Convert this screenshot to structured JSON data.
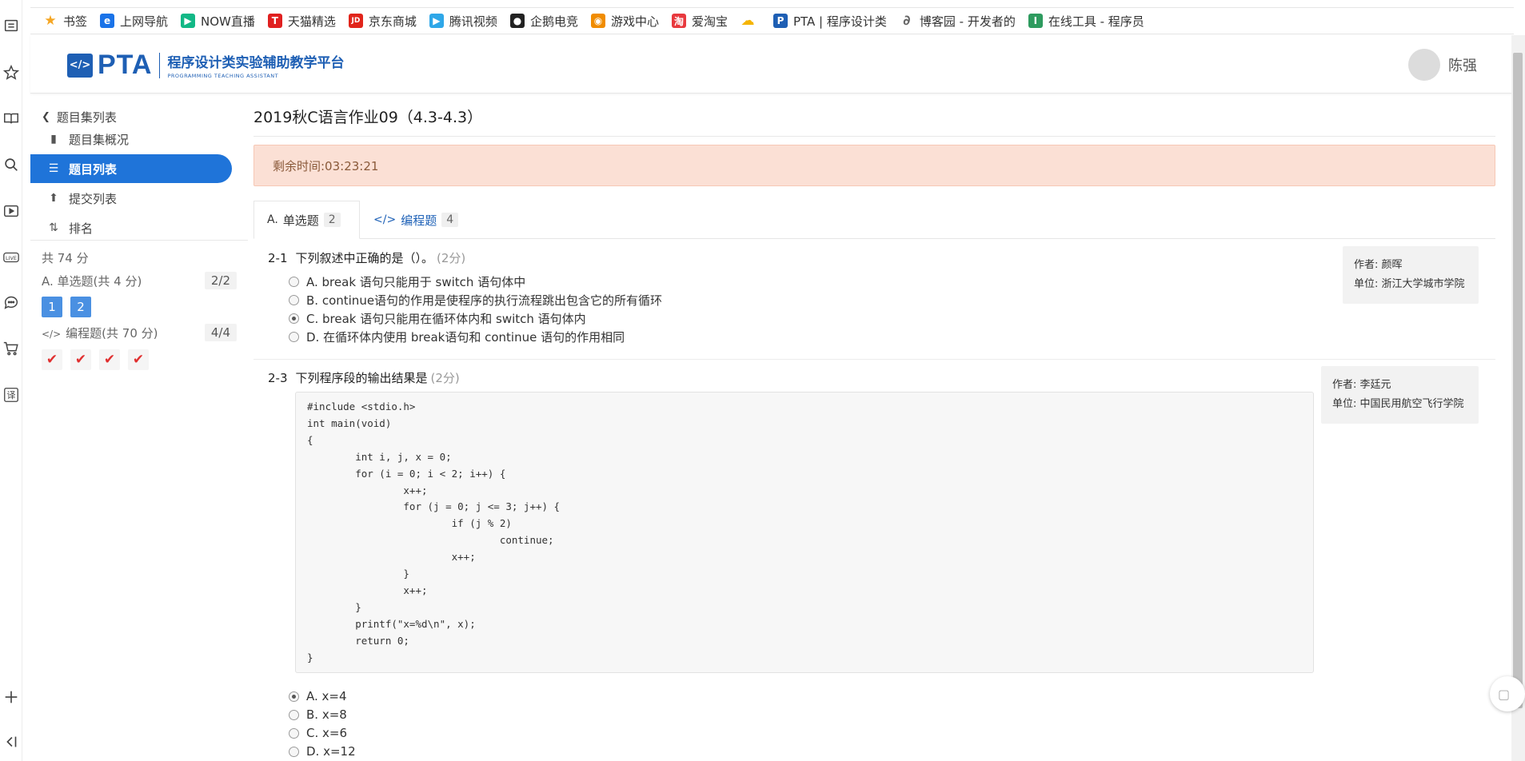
{
  "bookmarks": [
    {
      "label": "书签",
      "icon": "star-icon",
      "color": "#f5a623"
    },
    {
      "label": "上网导航",
      "icon": "ie-icon",
      "color": "#1a73e8"
    },
    {
      "label": "NOW直播",
      "icon": "now-icon",
      "color": "#12b886"
    },
    {
      "label": "天猫精选",
      "icon": "tmall-icon",
      "color": "#e02020"
    },
    {
      "label": "京东商城",
      "icon": "jd-icon",
      "color": "#e1251b"
    },
    {
      "label": "腾讯视频",
      "icon": "tencent-video-icon",
      "color": "#2fa7e8"
    },
    {
      "label": "企鹅电竞",
      "icon": "penguin-icon",
      "color": "#222222"
    },
    {
      "label": "游戏中心",
      "icon": "gamepad-icon",
      "color": "#f08c00"
    },
    {
      "label": "爱淘宝",
      "icon": "taobao-icon",
      "color": "#e8393e"
    },
    {
      "label": "",
      "icon": "cloud-icon",
      "color": "#f5b400"
    },
    {
      "label": "PTA | 程序设计类",
      "icon": "pta-icon",
      "color": "#1e5fb4"
    },
    {
      "label": "博客园 - 开发者的",
      "icon": "cnblogs-icon",
      "color": "#666666"
    },
    {
      "label": "在线工具 - 程序员",
      "icon": "tool-icon",
      "color": "#2e9b5f"
    }
  ],
  "header": {
    "logo_mark": "</>",
    "logo_text": "PTA",
    "platform_title": "程序设计类实验辅助教学平台",
    "platform_subtitle": "PROGRAMMING TEACHING ASSISTANT",
    "user_name": "陈强"
  },
  "sidebar": {
    "back_label": "题目集列表",
    "nav": [
      {
        "label": "题目集概况",
        "icon": "book-icon",
        "active": false
      },
      {
        "label": "题目列表",
        "icon": "list-icon",
        "active": true
      },
      {
        "label": "提交列表",
        "icon": "upload-icon",
        "active": false
      },
      {
        "label": "排名",
        "icon": "sort-icon",
        "active": false
      }
    ],
    "total": "共 74 分",
    "groups": [
      {
        "label": "A. 单选题(共 4 分)",
        "count": "2/2",
        "chips": [
          "1",
          "2"
        ]
      },
      {
        "label": "编程题(共 70 分)",
        "count": "4/4",
        "chips": [
          "✔",
          "✔",
          "✔",
          "✔"
        ]
      }
    ]
  },
  "main": {
    "title": "2019秋C语言作业09（4.3-4.3）",
    "timer": "剩余时间:03:23:21",
    "tabs": [
      {
        "label": "单选题",
        "prefix": "A.",
        "count": "2"
      },
      {
        "label": "编程题",
        "prefix": "</>",
        "count": "4"
      }
    ],
    "questions": [
      {
        "number": "2-1",
        "text": "下列叙述中正确的是（）。",
        "points": "(2分)",
        "author": "作者: 颜晖",
        "unit": "单位: 浙江大学城市学院",
        "options": [
          {
            "label": "A. break 语句只能用于 switch 语句体中",
            "selected": false
          },
          {
            "label": "B. continue语句的作用是使程序的执行流程跳出包含它的所有循环",
            "selected": false
          },
          {
            "label": "C. break 语句只能用在循环体内和 switch 语句体内",
            "selected": true
          },
          {
            "label": "D. 在循环体内使用 break语句和 continue 语句的作用相同",
            "selected": false
          }
        ]
      },
      {
        "number": "2-3",
        "text": "下列程序段的输出结果是",
        "points": "(2分)",
        "author": "作者: 李廷元",
        "unit": "单位: 中国民用航空飞行学院",
        "code": "#include <stdio.h>\nint main(void)\n{\n        int i, j, x = 0;\n        for (i = 0; i < 2; i++) {\n                x++;\n                for (j = 0; j <= 3; j++) {\n                        if (j % 2)\n                                continue;\n                        x++;\n                }\n                x++;\n        }\n        printf(\"x=%d\\n\", x);\n        return 0;\n}",
        "options": [
          {
            "label": "A. x=4",
            "selected": true
          },
          {
            "label": "B. x=8",
            "selected": false
          },
          {
            "label": "C. x=6",
            "selected": false
          },
          {
            "label": "D. x=12",
            "selected": false
          }
        ]
      }
    ]
  }
}
